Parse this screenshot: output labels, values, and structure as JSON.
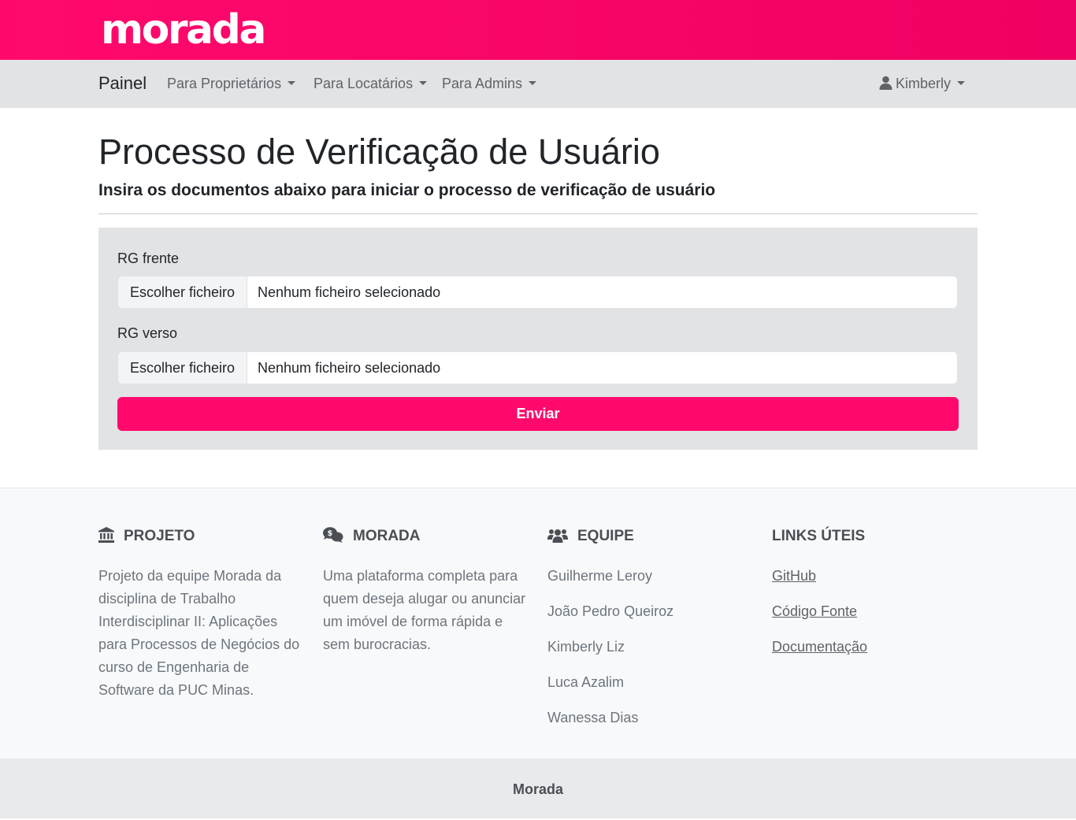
{
  "brand": {
    "logo": "morada",
    "color": "#ff0a6c"
  },
  "navbar": {
    "brand": "Painel",
    "menus": [
      {
        "label": "Para Proprietários"
      },
      {
        "label": "Para Locatários"
      },
      {
        "label": "Para Admins"
      }
    ],
    "user": {
      "name": "Kimberly",
      "icon": "user-icon"
    }
  },
  "main": {
    "title": "Processo de Verificação de Usuário",
    "subtitle": "Insira os documentos abaixo para iniciar o processo de verificação de usuário"
  },
  "form": {
    "fields": [
      {
        "label": "RG frente",
        "button": "Escolher ficheiro",
        "status": "Nenhum ficheiro selecionado"
      },
      {
        "label": "RG verso",
        "button": "Escolher ficheiro",
        "status": "Nenhum ficheiro selecionado"
      }
    ],
    "submit": "Enviar"
  },
  "footer": {
    "projeto": {
      "icon": "bank-icon",
      "heading": "PROJETO",
      "text": "Projeto da equipe Morada da disciplina de Trabalho Interdisciplinar II: Aplicações para Processos de Negócios do curso de Engenharia de Software da PUC Minas."
    },
    "morada": {
      "icon": "comments-dollar-icon",
      "heading": "MORADA",
      "text": "Uma plataforma completa para quem deseja alugar ou anunciar um imóvel de forma rápida e sem burocracias."
    },
    "equipe": {
      "icon": "users-icon",
      "heading": "EQUIPE",
      "members": [
        "Guilherme Leroy",
        "João Pedro Queiroz",
        "Kimberly Liz",
        "Luca Azalim",
        "Wanessa Dias"
      ]
    },
    "links": {
      "heading": "LINKS ÚTEIS",
      "items": [
        "GitHub",
        "Código Fonte",
        "Documentação"
      ]
    }
  },
  "bottom": {
    "text": "Morada"
  }
}
